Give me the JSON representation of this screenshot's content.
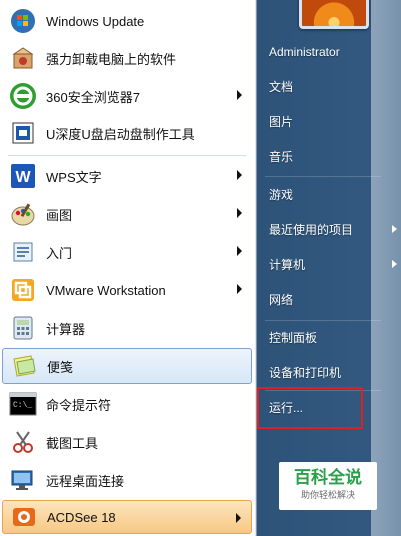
{
  "left_items": [
    {
      "label": "Windows Update",
      "icon": "windows-update-icon",
      "arrow": false
    },
    {
      "label": "强力卸载电脑上的软件",
      "icon": "uninstall-icon",
      "arrow": false
    },
    {
      "label": "360安全浏览器7",
      "icon": "360-browser-icon",
      "arrow": true
    },
    {
      "label": "U深度U盘启动盘制作工具",
      "icon": "usb-tool-icon",
      "arrow": false
    },
    {
      "label": "WPS文字",
      "icon": "wps-writer-icon",
      "arrow": true
    },
    {
      "label": "画图",
      "icon": "paint-icon",
      "arrow": true
    },
    {
      "label": "入门",
      "icon": "getting-started-icon",
      "arrow": true
    },
    {
      "label": "VMware Workstation",
      "icon": "vmware-icon",
      "arrow": true
    },
    {
      "label": "计算器",
      "icon": "calculator-icon",
      "arrow": false
    },
    {
      "label": "便笺",
      "icon": "sticky-notes-icon",
      "arrow": false
    },
    {
      "label": "命令提示符",
      "icon": "command-prompt-icon",
      "arrow": false
    },
    {
      "label": "截图工具",
      "icon": "snipping-tool-icon",
      "arrow": false
    },
    {
      "label": "远程桌面连接",
      "icon": "remote-desktop-icon",
      "arrow": false
    },
    {
      "label": "ACDSee 18",
      "icon": "acdsee-icon",
      "arrow": true
    }
  ],
  "right_items": [
    {
      "label": "Administrator",
      "arrow": false
    },
    {
      "label": "文档",
      "arrow": false
    },
    {
      "label": "图片",
      "arrow": false
    },
    {
      "label": "音乐",
      "arrow": false
    },
    {
      "label": "游戏",
      "arrow": false
    },
    {
      "label": "最近使用的项目",
      "arrow": true
    },
    {
      "label": "计算机",
      "arrow": true
    },
    {
      "label": "网络",
      "arrow": false
    },
    {
      "label": "控制面板",
      "arrow": false
    },
    {
      "label": "设备和打印机",
      "arrow": false
    },
    {
      "label": "运行...",
      "arrow": false
    }
  ],
  "watermark": {
    "title": "百科全说",
    "subtitle": "助你轻松解决"
  },
  "colors": {
    "highlight_box": "#e02020",
    "selected_item": "#d7e7f7",
    "last_item": "#f7c883"
  }
}
